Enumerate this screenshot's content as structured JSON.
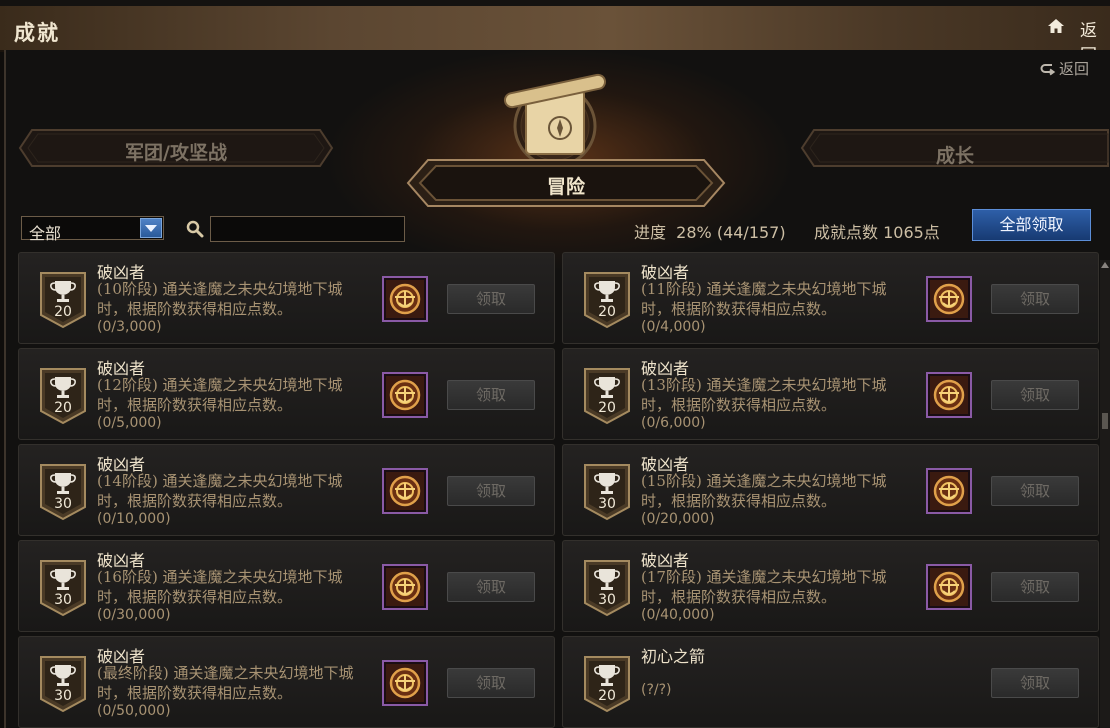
{
  "header": {
    "title": "成就",
    "back_label": "返回"
  },
  "nav": {
    "back_label": "返回"
  },
  "categories": [
    {
      "label": "军团/攻坚战",
      "active": false
    },
    {
      "label": "冒险",
      "active": true
    },
    {
      "label": "成长",
      "active": false
    }
  ],
  "filter": {
    "selected": "全部",
    "search_placeholder": ""
  },
  "stats": {
    "progress": "进度  28% (44/157)",
    "points": "成就点数 1065点"
  },
  "claim_all_label": "全部领取",
  "achievements": [
    {
      "points": "20",
      "name": "破凶者",
      "desc": "(10阶段) 通关逢魔之未央幻境地下城时，根据阶数获得相应点数。",
      "progress": "(0/3,000)",
      "claim": "领取"
    },
    {
      "points": "20",
      "name": "破凶者",
      "desc": "(11阶段) 通关逢魔之未央幻境地下城时，根据阶数获得相应点数。",
      "progress": "(0/4,000)",
      "claim": "领取"
    },
    {
      "points": "20",
      "name": "破凶者",
      "desc": "(12阶段) 通关逢魔之未央幻境地下城时，根据阶数获得相应点数。",
      "progress": "(0/5,000)",
      "claim": "领取"
    },
    {
      "points": "20",
      "name": "破凶者",
      "desc": "(13阶段) 通关逢魔之未央幻境地下城时，根据阶数获得相应点数。",
      "progress": "(0/6,000)",
      "claim": "领取"
    },
    {
      "points": "30",
      "name": "破凶者",
      "desc": "(14阶段) 通关逢魔之未央幻境地下城时，根据阶数获得相应点数。",
      "progress": "(0/10,000)",
      "claim": "领取"
    },
    {
      "points": "30",
      "name": "破凶者",
      "desc": "(15阶段) 通关逢魔之未央幻境地下城时，根据阶数获得相应点数。",
      "progress": "(0/20,000)",
      "claim": "领取"
    },
    {
      "points": "30",
      "name": "破凶者",
      "desc": "(16阶段) 通关逢魔之未央幻境地下城时，根据阶数获得相应点数。",
      "progress": "(0/30,000)",
      "claim": "领取"
    },
    {
      "points": "30",
      "name": "破凶者",
      "desc": "(17阶段) 通关逢魔之未央幻境地下城时，根据阶数获得相应点数。",
      "progress": "(0/40,000)",
      "claim": "领取"
    },
    {
      "points": "30",
      "name": "破凶者",
      "desc": "(最终阶段) 通关逢魔之未央幻境地下城时，根据阶数获得相应点数。",
      "progress": "(0/50,000)",
      "claim": "领取"
    },
    {
      "points": "20",
      "name": "初心之箭",
      "desc": "",
      "progress": "(?/?)",
      "claim": "领取"
    }
  ]
}
